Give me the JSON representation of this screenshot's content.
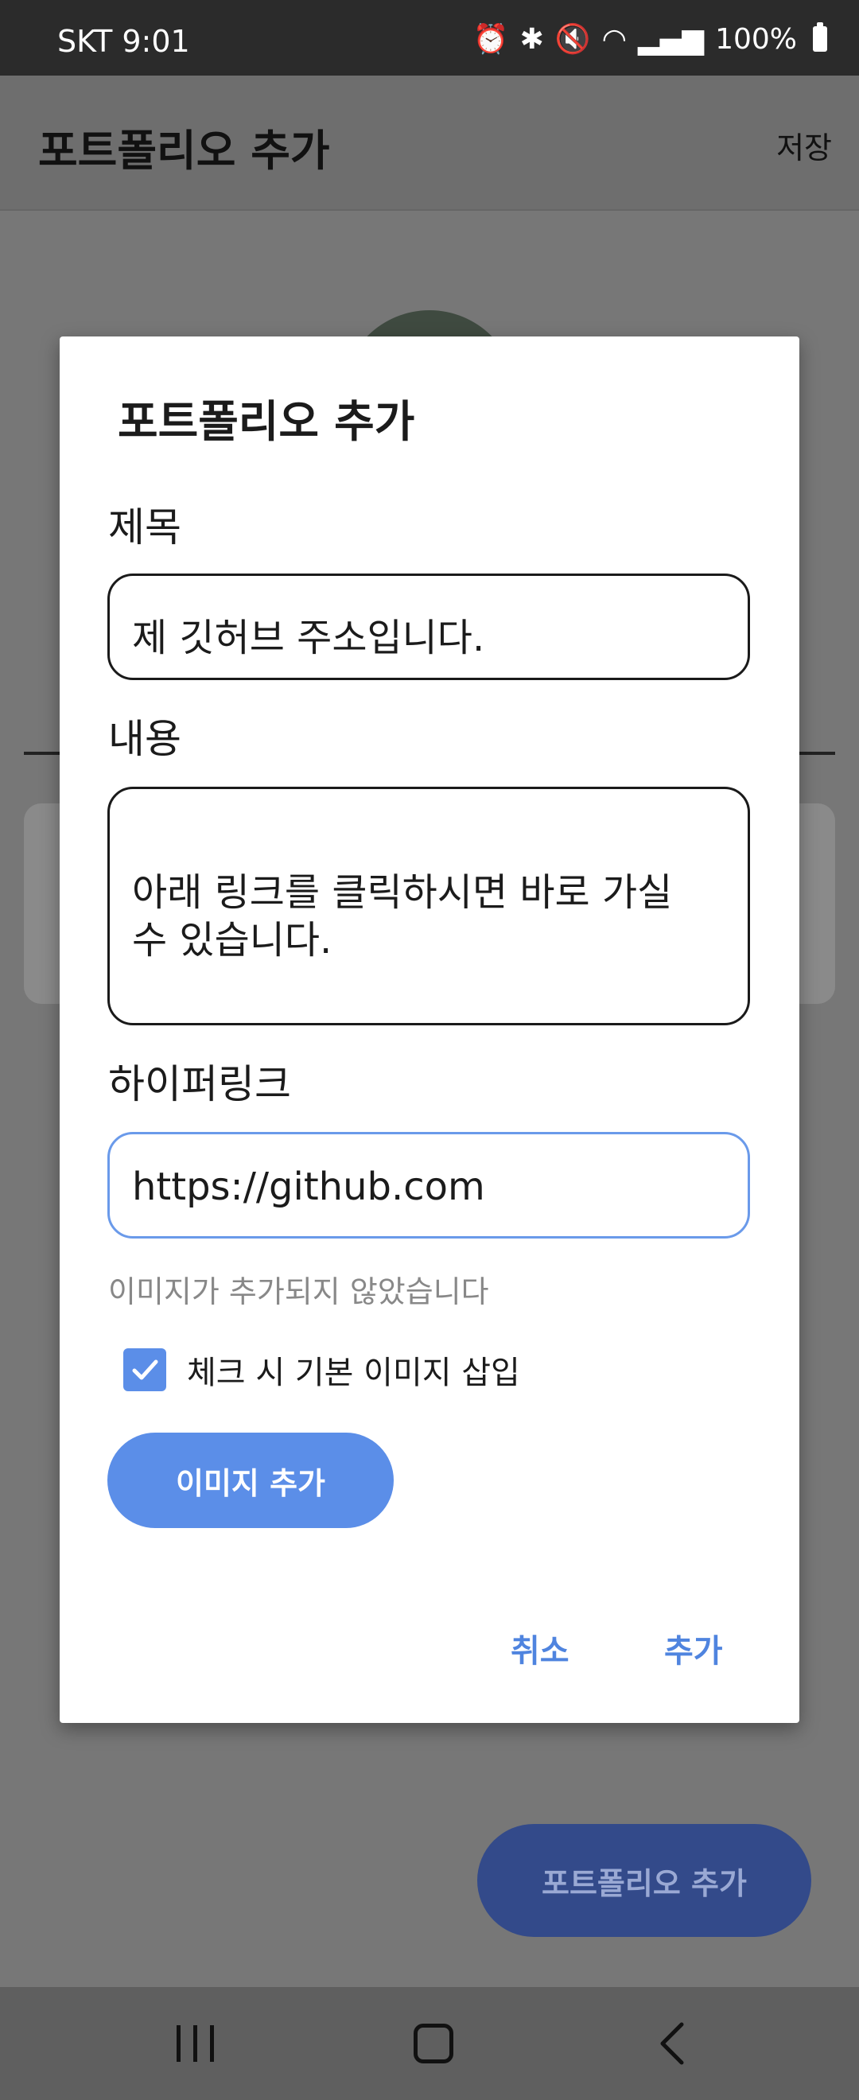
{
  "status_bar": {
    "carrier_time": "SKT  9:01",
    "battery": "100%",
    "icons": [
      "alarm-icon",
      "bluetooth-icon",
      "mute-icon",
      "wifi-icon",
      "signal-icon",
      "battery-icon"
    ]
  },
  "app_bar": {
    "title": "포트폴리오 추가",
    "save_label": "저장"
  },
  "fab": {
    "label": "포트폴리오 추가"
  },
  "dialog": {
    "title": "포트폴리오 추가",
    "title_field": {
      "label": "제목",
      "value": "제 깃허브 주소입니다."
    },
    "content_field": {
      "label": "내용",
      "value_line1": "아래 링크를 클릭하시면 바로 가실",
      "value_line2": "수 있습니다."
    },
    "link_field": {
      "label": "하이퍼링크",
      "value": "https://github.com"
    },
    "image_status": "이미지가 추가되지 않았습니다",
    "default_image_checkbox": {
      "label": "체크 시 기본 이미지 삽입",
      "checked": true
    },
    "add_image_button": "이미지 추가",
    "cancel_button": "취소",
    "confirm_button": "추가"
  },
  "colors": {
    "accent": "#5b8ee8",
    "action_text": "#4f84df",
    "scrim": "#777777"
  }
}
